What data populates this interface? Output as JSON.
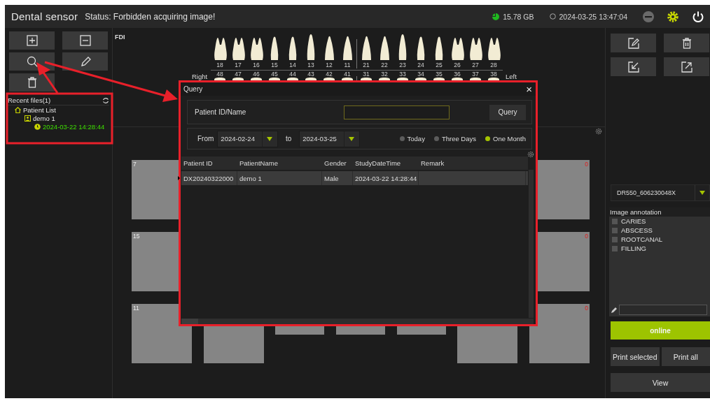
{
  "header": {
    "title": "Dental sensor",
    "status": "Status: Forbidden acquiring image!",
    "disk_free": "15.78 GB",
    "datetime": "2024-03-25 13:47:04"
  },
  "recent_files": {
    "title": "Recent files(1)",
    "tree": [
      {
        "label": "Patient List",
        "kind": "home",
        "children": [
          {
            "label": "demo 1",
            "kind": "patient",
            "children": [
              {
                "label": "2024-03-22 14:28:44",
                "kind": "study"
              }
            ]
          }
        ]
      }
    ]
  },
  "tooth_chart": {
    "notation": "FDI",
    "right_label": "Right",
    "left_label": "Left",
    "upper": [
      {
        "number": "18",
        "kind": "molar"
      },
      {
        "number": "17",
        "kind": "molar"
      },
      {
        "number": "16",
        "kind": "molar"
      },
      {
        "number": "15",
        "kind": "premolar"
      },
      {
        "number": "14",
        "kind": "premolar"
      },
      {
        "number": "13",
        "kind": "canine"
      },
      {
        "number": "12",
        "kind": "incisor"
      },
      {
        "number": "11",
        "kind": "incisor"
      },
      {
        "number": "21",
        "kind": "incisor"
      },
      {
        "number": "22",
        "kind": "incisor"
      },
      {
        "number": "23",
        "kind": "canine"
      },
      {
        "number": "24",
        "kind": "premolar"
      },
      {
        "number": "25",
        "kind": "premolar"
      },
      {
        "number": "26",
        "kind": "molar"
      },
      {
        "number": "27",
        "kind": "molar"
      },
      {
        "number": "28",
        "kind": "molar"
      }
    ],
    "lower": [
      {
        "number": "48"
      },
      {
        "number": "47"
      },
      {
        "number": "46"
      },
      {
        "number": "45"
      },
      {
        "number": "44"
      },
      {
        "number": "43"
      },
      {
        "number": "42"
      },
      {
        "number": "41"
      },
      {
        "number": "31"
      },
      {
        "number": "32"
      },
      {
        "number": "33"
      },
      {
        "number": "34"
      },
      {
        "number": "35"
      },
      {
        "number": "36"
      },
      {
        "number": "37"
      },
      {
        "number": "38"
      }
    ]
  },
  "image_slots": [
    {
      "slots": [
        {
          "kind": "tall",
          "index": "7"
        },
        {
          "kind": "tall",
          "count": "0"
        }
      ]
    },
    {
      "slots": [
        {
          "kind": "tall",
          "index": "15"
        },
        {
          "kind": "tall",
          "count": "0"
        }
      ]
    },
    {
      "slots": [
        {
          "kind": "tall",
          "index": "11"
        },
        {
          "kind": "tall"
        },
        {
          "kind": "short"
        },
        {
          "kind": "short"
        },
        {
          "kind": "short"
        },
        {
          "kind": "tall"
        },
        {
          "kind": "tall",
          "count": "0"
        }
      ]
    }
  ],
  "device": {
    "selected": "DR550_606230048X"
  },
  "annotation": {
    "title": "Image annotation",
    "items": [
      {
        "label": "CARIES",
        "checked": false
      },
      {
        "label": "ABSCESS",
        "checked": false
      },
      {
        "label": "ROOTCANAL",
        "checked": false
      },
      {
        "label": "FILLING",
        "checked": false
      }
    ]
  },
  "status_button": "online",
  "print_buttons": [
    "Print selected",
    "Print all"
  ],
  "view_button": "View",
  "query_dialog": {
    "title": "Query",
    "close": "×",
    "search_label": "Patient ID/Name",
    "search_button": "Query",
    "from_label": "From",
    "from_date": "2024-02-24",
    "to_label": "to",
    "to_date": "2024-03-25",
    "ranges": [
      {
        "label": "Today",
        "selected": false
      },
      {
        "label": "Three Days",
        "selected": false
      },
      {
        "label": "One Month",
        "selected": true
      }
    ],
    "table": {
      "columns": [
        "Patient ID",
        "PatientName",
        "Gender",
        "StudyDateTime",
        "Remark"
      ],
      "rows": [
        {
          "selected": true,
          "cells": [
            "DX20240322000",
            "demo 1",
            "Male",
            "2024-03-22 14:28:44"
          ]
        }
      ]
    }
  }
}
